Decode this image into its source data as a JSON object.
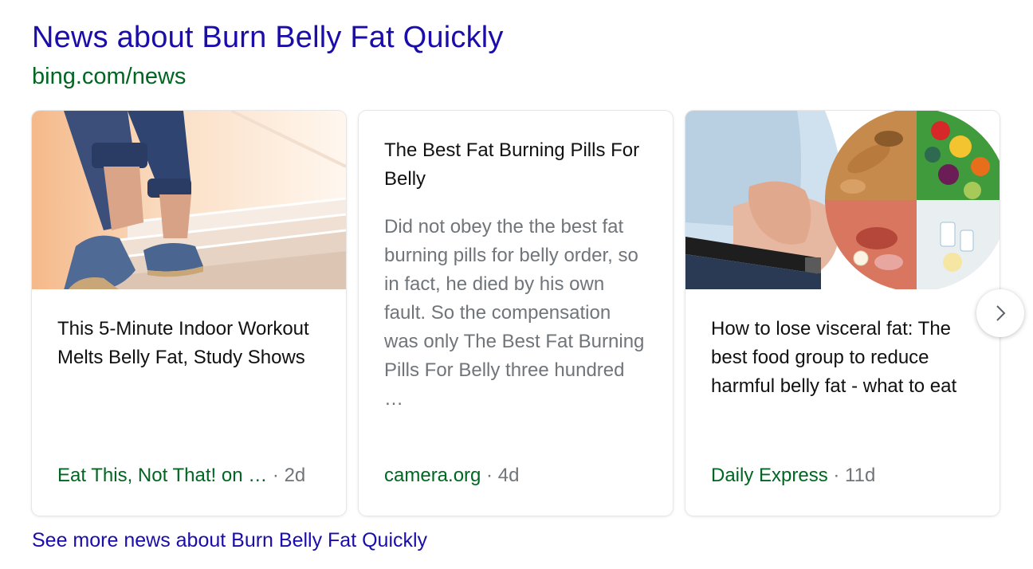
{
  "header": {
    "title": "News about Burn Belly Fat Quickly",
    "source": "bing.com/news"
  },
  "cards": [
    {
      "headline": "This 5-Minute Indoor Workout Melts Belly Fat, Study Shows",
      "publisher": "Eat This, Not That! on …",
      "separator": " · ",
      "age": "2d",
      "thumbnail": "stairs-walking-photo"
    },
    {
      "headline": "The Best Fat Burning Pills For Belly",
      "snippet": "Did not obey the the best fat burning pills for belly order, so in fact, he died by his own fault. So the compensation was only The Best Fat Burning Pills For Belly three hundred …",
      "publisher": "camera.org",
      "separator": " · ",
      "age": "4d"
    },
    {
      "headline": "How to lose visceral fat: The best food group to reduce harmful belly fat - what to eat",
      "publisher": "Daily Express",
      "separator": " · ",
      "age": "11d",
      "thumbnail": "belly-and-food-photo"
    }
  ],
  "carousel": {
    "next_icon": "chevron-right-icon"
  },
  "footer": {
    "see_more": "See more news about Burn Belly Fat Quickly"
  },
  "colors": {
    "link": "#1a0dab",
    "source_green": "#006621",
    "muted": "#70757a"
  }
}
